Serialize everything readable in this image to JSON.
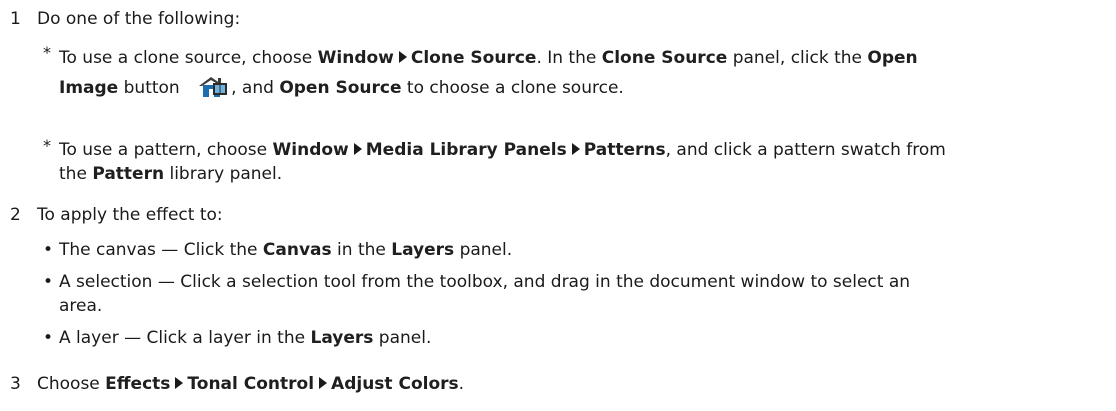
{
  "steps": [
    {
      "num": "1",
      "text": "Do one of the following:",
      "bullets": [
        {
          "line1": {
            "a": "To use a clone source, choose ",
            "b": "Window",
            "c": "Clone Source",
            "d": ". In the ",
            "e": "Clone Source",
            "f": " panel, click the ",
            "g": "Open"
          },
          "line2": {
            "a": "Image",
            "b": " button ",
            "icon": "open-image-icon",
            "c": ", and ",
            "d": "Open Source",
            "e": " to choose a clone source."
          }
        },
        {
          "line1": {
            "a": "To use a pattern, choose ",
            "b": "Window",
            "c": "Media Library Panels",
            "d": "Patterns",
            "e": ", and click a pattern swatch from"
          },
          "line2": {
            "a": "the ",
            "b": "Pattern",
            "c": " library panel."
          }
        }
      ]
    },
    {
      "num": "2",
      "text": "To apply the effect to:",
      "bullets": [
        {
          "a": "The canvas — Click the ",
          "b": "Canvas",
          "c": " in the ",
          "d": "Layers",
          "e": " panel."
        },
        {
          "line1": "A selection — Click a selection tool from the toolbox, and drag in the document window to select an",
          "line2": "area."
        },
        {
          "a": "A layer — Click a layer in the ",
          "b": "Layers",
          "c": " panel."
        }
      ]
    },
    {
      "num": "3",
      "a": "Choose ",
      "b": "Effects",
      "c": "Tonal Control",
      "d": "Adjust Colors",
      "e": "."
    }
  ],
  "colors": {
    "text": "#1a1a1a",
    "icon_house": "#1c6fae",
    "icon_roof": "#3a3a3a"
  }
}
